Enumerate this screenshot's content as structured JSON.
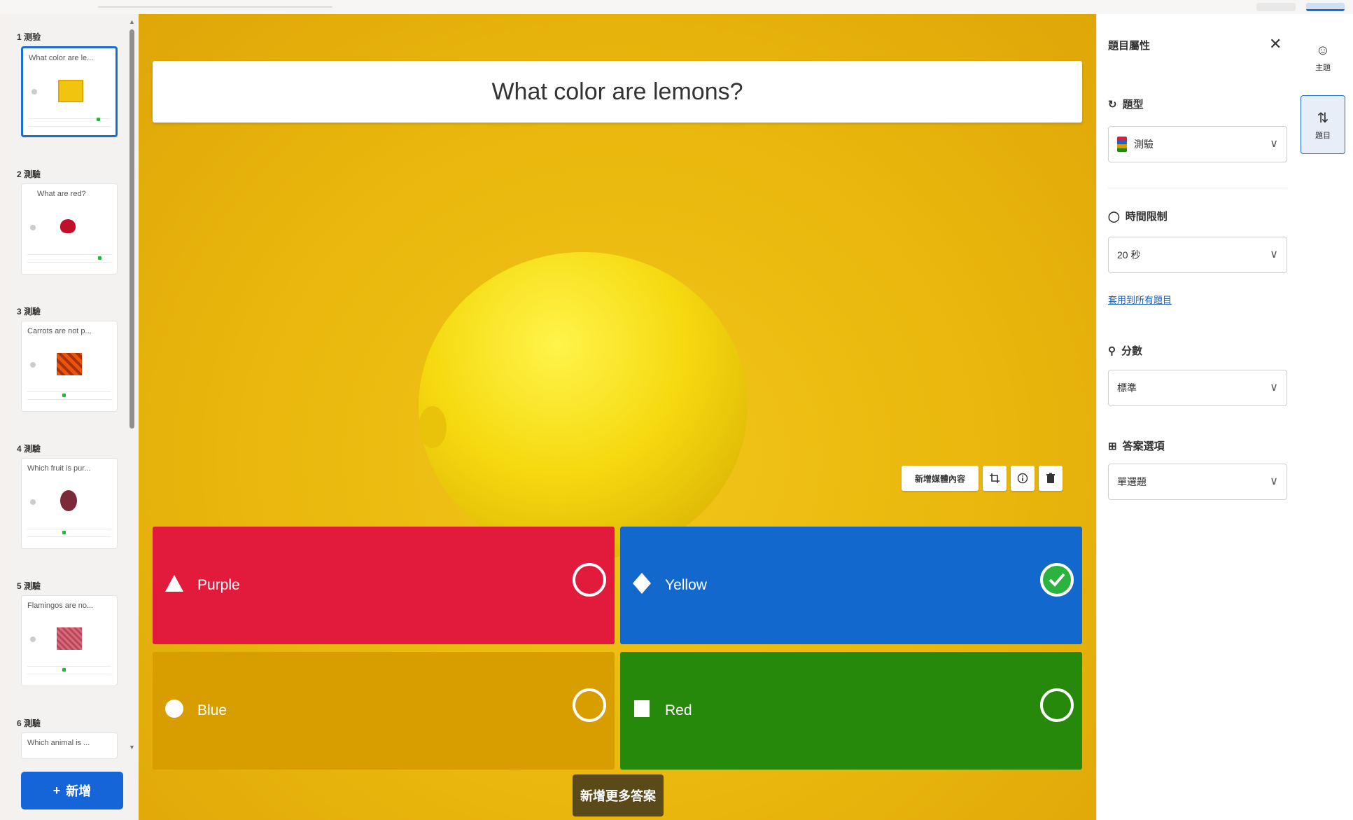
{
  "slides": {
    "items": [
      {
        "head": "1 测验",
        "question": "What color are le..."
      },
      {
        "head": "2 測驗",
        "question": "What are red?"
      },
      {
        "head": "3 測驗",
        "question": "Carrots are not p..."
      },
      {
        "head": "4 測驗",
        "question": "Which fruit is pur..."
      },
      {
        "head": "5 測驗",
        "question": "Flamingos are no..."
      },
      {
        "head": "6 測驗",
        "question": "Which animal is ..."
      }
    ],
    "add_label": "新增"
  },
  "main": {
    "question": "What color are lemons?",
    "media_tools": {
      "replace": "新增媒體內容"
    },
    "answers": [
      {
        "label": "Purple",
        "correct": false
      },
      {
        "label": "Yellow",
        "correct": true
      },
      {
        "label": "Blue",
        "correct": false
      },
      {
        "label": "Red",
        "correct": false
      }
    ],
    "add_more": "新增更多答案"
  },
  "props": {
    "title": "題目屬性",
    "type_label": "題型",
    "type_value": "測驗",
    "time_label": "時間限制",
    "time_value": "20 秒",
    "time_link": "套用到所有題目",
    "points_label": "分數",
    "points_value": "標準",
    "answer_opt_label": "答案選項",
    "answer_opt_value": "單選題"
  },
  "rail": {
    "item1": "主題",
    "item2": "題目"
  },
  "colors": {
    "red": "#e21b3c",
    "blue": "#1368ce",
    "yellow": "#d89e00",
    "green": "#26890c",
    "accent": "#1565d8"
  }
}
